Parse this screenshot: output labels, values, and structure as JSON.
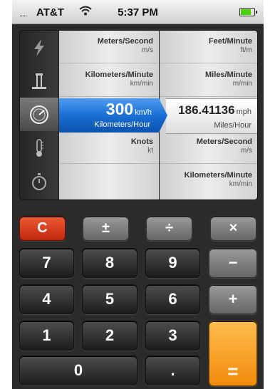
{
  "status_bar": {
    "signal": ".....",
    "carrier": "AT&T",
    "time": "5:37 PM"
  },
  "categories": [
    {
      "icon": "lightning-icon",
      "label": "Energy"
    },
    {
      "icon": "weight-icon",
      "label": "Weight"
    },
    {
      "icon": "speedometer-icon",
      "label": "Speed",
      "selected": true
    },
    {
      "icon": "thermometer-icon",
      "label": "Temperature"
    },
    {
      "icon": "stopwatch-icon",
      "label": "Time"
    }
  ],
  "left_units": [
    {
      "name": "Meters/Second",
      "abbr": "m/s"
    },
    {
      "name": "Kilometers/Minute",
      "abbr": "km/min"
    },
    {
      "name": "",
      "abbr": ""
    },
    {
      "name": "Knots",
      "abbr": "kt"
    },
    {
      "name": "",
      "abbr": ""
    }
  ],
  "right_units": [
    {
      "name": "Feet/Minute",
      "abbr": "ft/m"
    },
    {
      "name": "Miles/Minute",
      "abbr": "m/min"
    },
    {
      "name": "",
      "abbr": ""
    },
    {
      "name": "Meters/Second",
      "abbr": "m/s"
    },
    {
      "name": "Kilometers/Minute",
      "abbr": "km/min"
    }
  ],
  "selected": {
    "from_value": "300",
    "from_abbr": "km/h",
    "from_unit": "Kilometers/Hour",
    "to_value": "186.41136",
    "to_abbr": "mph",
    "to_unit": "Miles/Hour"
  },
  "keypad": {
    "clear": "C",
    "plus_minus": "±",
    "divide": "÷",
    "multiply": "×",
    "seven": "7",
    "eight": "8",
    "nine": "9",
    "minus": "−",
    "four": "4",
    "five": "5",
    "six": "6",
    "plus": "+",
    "one": "1",
    "two": "2",
    "three": "3",
    "equals": "=",
    "zero": "0",
    "decimal": "."
  },
  "colors": {
    "accent_blue": "#1a6fd6",
    "clear_red": "#d9391b",
    "equals_orange": "#f5a021"
  }
}
